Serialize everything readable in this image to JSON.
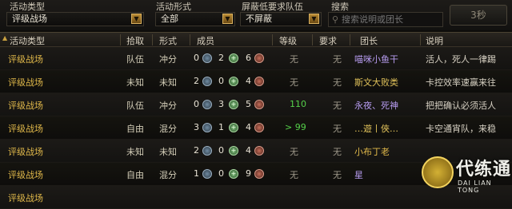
{
  "filters": {
    "activity_type": {
      "label": "活动类型",
      "value": "评级战场"
    },
    "activity_form": {
      "label": "活动形式",
      "value": "全部"
    },
    "shield": {
      "label": "屏蔽低要求队伍",
      "value": "不屏蔽"
    },
    "search": {
      "label": "搜索",
      "placeholder": "搜索说明或团长"
    },
    "refresh_label": "3秒"
  },
  "columns": {
    "type": "活动类型",
    "pick": "拾取",
    "form": "形式",
    "members": "成员",
    "level": "等级",
    "req": "要求",
    "leader": "团长",
    "desc": "说明"
  },
  "rows": [
    {
      "type": "评级战场",
      "pick": "队伍",
      "form": "冲分",
      "tank": "0",
      "heal": "2",
      "dps": "6",
      "level": "无",
      "req": "无",
      "leader": "喵咪小鱼干",
      "desc": "活人，死人一律踢"
    },
    {
      "type": "评级战场",
      "pick": "未知",
      "form": "未知",
      "tank": "2",
      "heal": "0",
      "dps": "4",
      "level": "无",
      "req": "无",
      "leader": "斯文大败类",
      "desc": "卡控效率速赢来往"
    },
    {
      "type": "评级战场",
      "pick": "队伍",
      "form": "冲分",
      "tank": "0",
      "heal": "3",
      "dps": "5",
      "level": "110",
      "req": "无",
      "leader": "永夜、死神",
      "desc": "把把确认必须活人"
    },
    {
      "type": "评级战场",
      "pick": "自由",
      "form": "混分",
      "tank": "3",
      "heal": "1",
      "dps": "4",
      "level": "> 99",
      "req": "无",
      "leader": "…遊丨俠…",
      "desc": "卡空通宵队，来稳"
    },
    {
      "type": "评级战场",
      "pick": "未知",
      "form": "未知",
      "tank": "2",
      "heal": "0",
      "dps": "4",
      "level": "无",
      "req": "无",
      "leader": "小布丁老",
      "desc": ""
    },
    {
      "type": "评级战场",
      "pick": "自由",
      "form": "混分",
      "tank": "1",
      "heal": "0",
      "dps": "9",
      "level": "无",
      "req": "无",
      "leader": "星",
      "desc": ""
    },
    {
      "type": "评级战场",
      "pick": "",
      "form": "",
      "tank": "",
      "heal": "",
      "dps": "",
      "level": "",
      "req": "",
      "leader": "",
      "desc": ""
    }
  ],
  "colors": {
    "accent_gold": "#e0b84a",
    "level_green": "#55d04a",
    "leader_colors": [
      "#b79cf0",
      "#e0c15a",
      "#b79cf0",
      "#e0c15a",
      "#e0b84a",
      "#b79cf0",
      "#d4ceb8"
    ]
  },
  "icons": {
    "tank": "shield-icon",
    "heal": "plus-icon",
    "dps": "sword-icon",
    "search": "magnifier-icon",
    "dropdown": "triangle-down-icon"
  },
  "watermark": {
    "text": "代练通",
    "sub": "DAI LIAN TONG"
  }
}
